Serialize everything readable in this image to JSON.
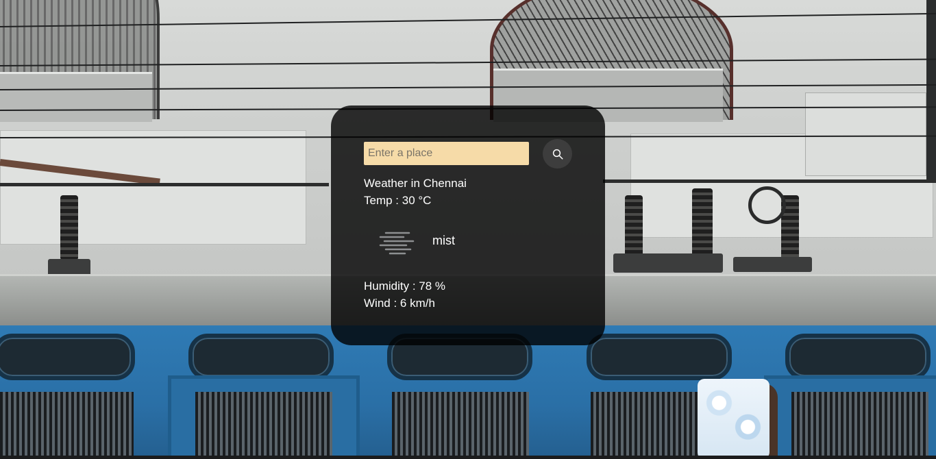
{
  "search": {
    "placeholder": "Enter a place",
    "value": "",
    "button_icon": "search-icon"
  },
  "weather": {
    "location_line": "Weather in Chennai",
    "temp_line": "Temp : 30 °C",
    "condition_icon": "mist-icon",
    "condition": "mist",
    "humidity_line": "Humidity : 78 %",
    "wind_line": "Wind : 6 km/h"
  },
  "colors": {
    "card_background": "#000000cc",
    "input_background": "#f6dba8",
    "button_background": "#3d3d3d",
    "text": "#ffffff"
  }
}
